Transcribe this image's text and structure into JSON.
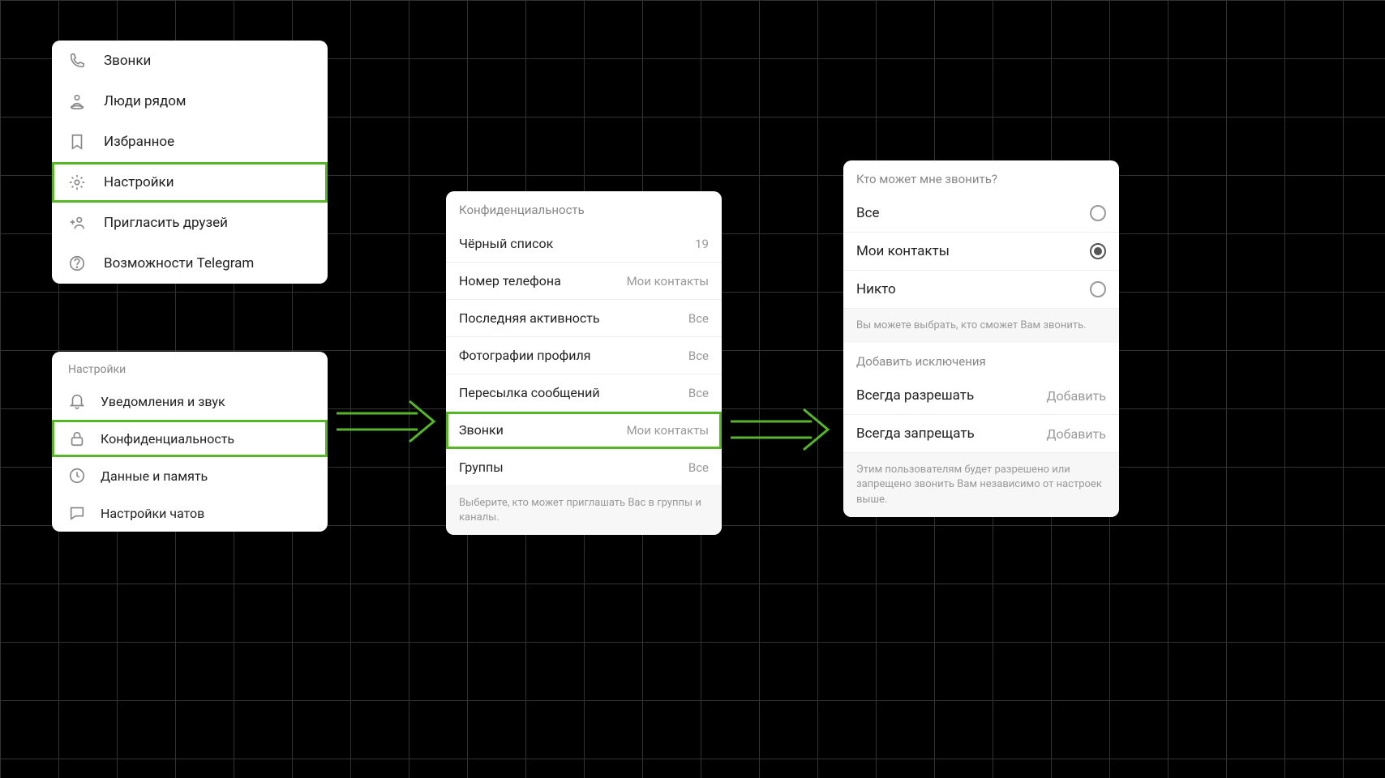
{
  "menu": {
    "items": [
      {
        "label": "Звонки",
        "icon": "phone-icon",
        "highlight": false
      },
      {
        "label": "Люди рядом",
        "icon": "people-nearby-icon",
        "highlight": false
      },
      {
        "label": "Избранное",
        "icon": "bookmark-icon",
        "highlight": false
      },
      {
        "label": "Настройки",
        "icon": "gear-icon",
        "highlight": true
      },
      {
        "label": "Пригласить друзей",
        "icon": "invite-icon",
        "highlight": false
      },
      {
        "label": "Возможности Telegram",
        "icon": "help-icon",
        "highlight": false
      }
    ]
  },
  "settings": {
    "title": "Настройки",
    "items": [
      {
        "label": "Уведомления и звук",
        "icon": "bell-icon",
        "highlight": false
      },
      {
        "label": "Конфиденциальность",
        "icon": "lock-icon",
        "highlight": true
      },
      {
        "label": "Данные и память",
        "icon": "data-icon",
        "highlight": false
      },
      {
        "label": "Настройки чатов",
        "icon": "chat-icon",
        "highlight": false
      }
    ]
  },
  "privacy": {
    "header": "Конфиденциальность",
    "items": [
      {
        "label": "Чёрный список",
        "value": "19",
        "highlight": false
      },
      {
        "label": "Номер телефона",
        "value": "Мои контакты",
        "highlight": false
      },
      {
        "label": "Последняя активность",
        "value": "Все",
        "highlight": false
      },
      {
        "label": "Фотографии профиля",
        "value": "Все",
        "highlight": false
      },
      {
        "label": "Пересылка сообщений",
        "value": "Все",
        "highlight": false
      },
      {
        "label": "Звонки",
        "value": "Мои контакты",
        "highlight": true
      },
      {
        "label": "Группы",
        "value": "Все",
        "highlight": false
      }
    ],
    "hint": "Выберите, кто может приглашать Вас в группы и каналы."
  },
  "calls": {
    "header": "Кто может мне звонить?",
    "options": [
      {
        "label": "Все",
        "selected": false
      },
      {
        "label": "Мои контакты",
        "selected": true
      },
      {
        "label": "Никто",
        "selected": false
      }
    ],
    "hint1": "Вы можете выбрать, кто сможет Вам звонить.",
    "exceptions_header": "Добавить исключения",
    "exceptions": [
      {
        "label": "Всегда разрешать",
        "action": "Добавить"
      },
      {
        "label": "Всегда запрещать",
        "action": "Добавить"
      }
    ],
    "hint2": "Этим пользователям будет разрешено или запрещено звонить Вам независимо от настроек выше."
  }
}
